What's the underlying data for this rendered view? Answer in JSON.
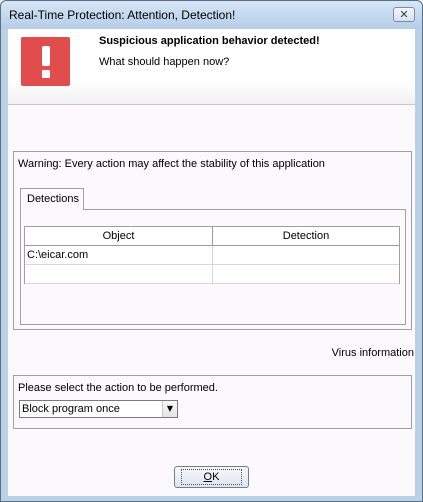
{
  "window": {
    "title": "Real-Time Protection: Attention, Detection!",
    "close_glyph": "✕"
  },
  "header": {
    "icon": "exclamation-icon",
    "icon_color": "#e14d4d",
    "title": "Suspicious application behavior detected!",
    "subtitle": "What should happen now?"
  },
  "warning": {
    "text": "Warning: Every action may affect the stability of this application",
    "tabs": [
      {
        "label": "Detections"
      }
    ],
    "table": {
      "columns": [
        "Object",
        "Detection"
      ],
      "rows": [
        [
          "C:\\eicar.com",
          ""
        ],
        [
          "",
          ""
        ]
      ]
    }
  },
  "virus_info_link": "Virus information",
  "action": {
    "label": "Please select the action to be performed.",
    "selected": "Block program once",
    "dropdown_glyph": "▼"
  },
  "buttons": {
    "ok_accel": "O",
    "ok_rest": "K"
  }
}
